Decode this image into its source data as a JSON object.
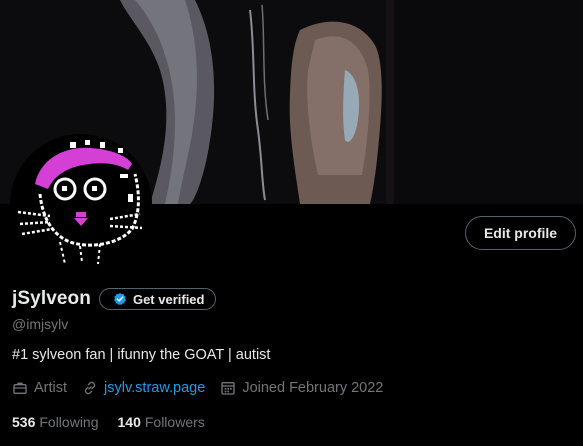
{
  "profile": {
    "display_name": "jSylveon",
    "handle": "@imjsylv",
    "bio": "#1 sylveon fan | ifunny the GOAT | autist",
    "edit_profile_label": "Edit profile",
    "get_verified_label": "Get verified",
    "profession": "Artist",
    "website": "jsylv.straw.page",
    "joined": "Joined February 2022",
    "following_count": "536",
    "following_label": "Following",
    "followers_count": "140",
    "followers_label": "Followers"
  },
  "icons": {
    "verified": "verified-badge-icon",
    "profession": "briefcase-icon",
    "website": "link-icon",
    "joined": "calendar-icon"
  },
  "colors": {
    "background": "#000000",
    "text_primary": "#e7e9ea",
    "text_secondary": "#71767b",
    "accent_link": "#1d9bf0",
    "button_border": "#536471"
  }
}
